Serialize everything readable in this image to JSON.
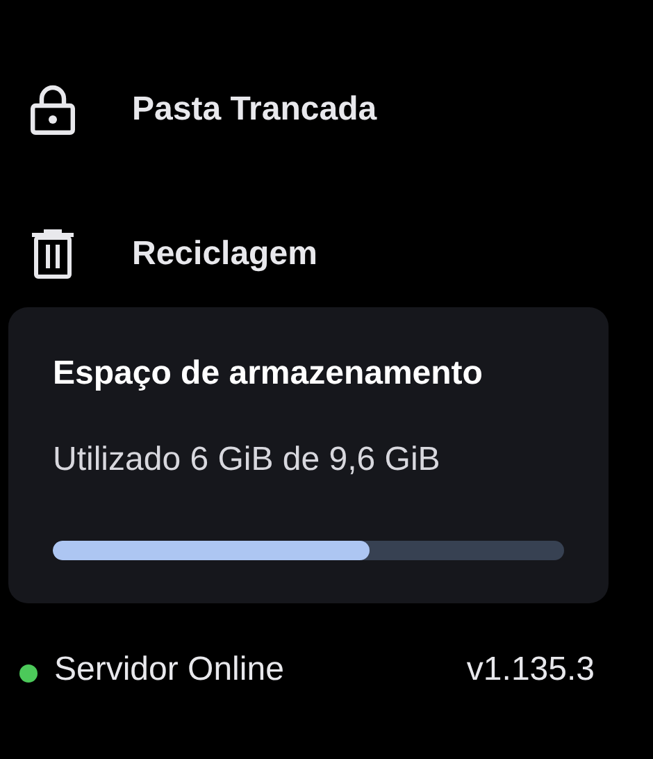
{
  "nav_items": [
    {
      "kind": "lock",
      "label": "Pasta Trancada"
    },
    {
      "kind": "trash",
      "label": "Reciclagem"
    }
  ],
  "storage": {
    "title": "Espaço de armazenamento",
    "usage": "Utilizado 6 GiB de 9,6 GiB",
    "level": 0.62
  },
  "status_bar": {
    "online": true,
    "status": "Servidor Online",
    "version": "v1.135.3"
  }
}
